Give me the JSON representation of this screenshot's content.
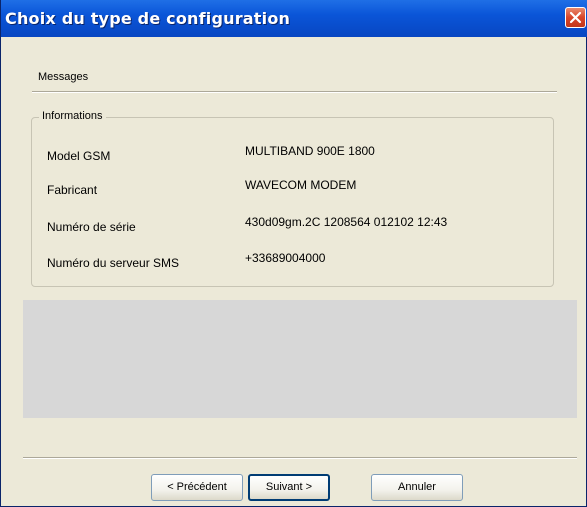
{
  "window": {
    "title": "Choix du type de configuration"
  },
  "messages_label": "Messages",
  "group": {
    "title": "Informations",
    "rows": [
      {
        "label": "Model GSM",
        "value": "MULTIBAND  900E  1800"
      },
      {
        "label": "Fabricant",
        "value": "WAVECOM MODEM"
      },
      {
        "label": "Numéro de série",
        "value": "430d09gm.2C 1208564 012102 12:43"
      },
      {
        "label": "Numéro du serveur SMS",
        "value": "+33689004000"
      }
    ]
  },
  "buttons": {
    "previous": "< Précédent",
    "next": "Suivant >",
    "cancel": "Annuler"
  },
  "colors": {
    "titlebar": "#0a55d8",
    "dialog_bg": "#ece9d8",
    "close_button": "#d9452a",
    "panel_gray": "#d7d7d7"
  },
  "icons": {
    "close": "close-icon"
  }
}
